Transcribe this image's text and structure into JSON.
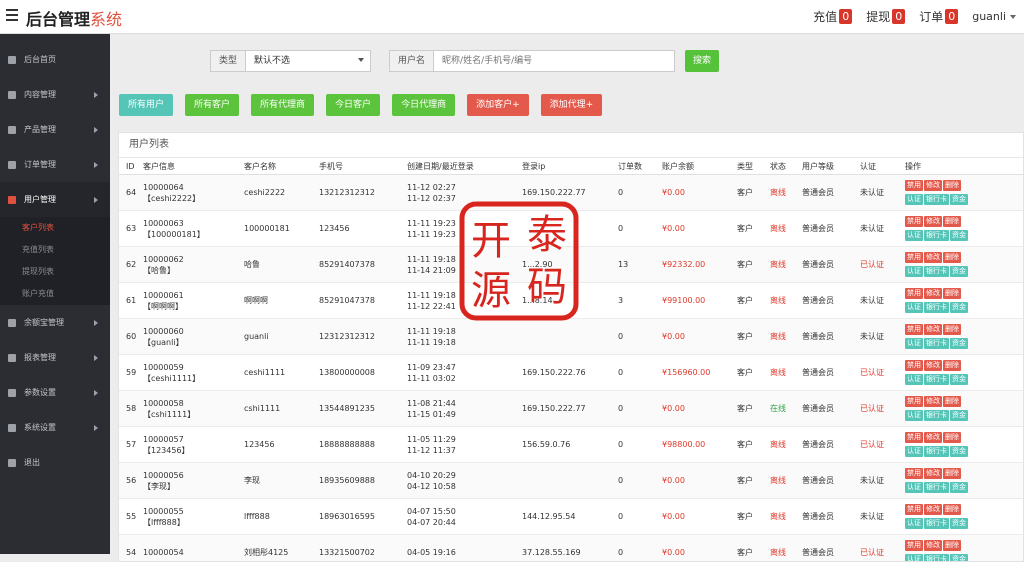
{
  "header": {
    "brand_main": "后台管理",
    "brand_accent": "系统",
    "nav": [
      {
        "label": "充值",
        "count": "0"
      },
      {
        "label": "提现",
        "count": "0"
      },
      {
        "label": "订单",
        "count": "0"
      }
    ],
    "user": "guanli"
  },
  "sidebar": {
    "items": [
      {
        "label": "后台首页"
      },
      {
        "label": "内容管理"
      },
      {
        "label": "产品管理"
      },
      {
        "label": "订单管理"
      },
      {
        "label": "用户管理"
      },
      {
        "label": "余额宝管理"
      },
      {
        "label": "报表管理"
      },
      {
        "label": "参数设置"
      },
      {
        "label": "系统设置"
      },
      {
        "label": "退出"
      }
    ],
    "submenu": [
      "客户列表",
      "充值列表",
      "提现列表",
      "账户充值"
    ]
  },
  "filter": {
    "type_label": "类型",
    "type_value": "默认不选",
    "user_label": "用户名",
    "user_placeholder": "昵称/姓名/手机号/编号",
    "search_label": "搜索"
  },
  "quick_buttons": [
    "所有用户",
    "所有客户",
    "所有代理商",
    "今日客户",
    "今日代理商",
    "添加客户+",
    "添加代理+"
  ],
  "table": {
    "title": "用户列表",
    "headers": [
      "ID",
      "客户信息",
      "客户名称",
      "手机号",
      "创建日期/最近登录",
      "登录ip",
      "订单数",
      "账户余额",
      "类型",
      "状态",
      "用户等级",
      "认证",
      "操作"
    ],
    "ops": [
      "禁用",
      "修改",
      "删除",
      "认证",
      "银行卡",
      "资金"
    ],
    "rows": [
      {
        "id": "64",
        "code": "10000064",
        "nick": "【ceshi2222】",
        "name": "ceshi2222",
        "phone": "13212312312",
        "created": "11-12 02:27",
        "login": "11-12 02:37",
        "ip": "169.150.222.77",
        "orders": "0",
        "balance": "¥0.00",
        "type": "客户",
        "status": "离线",
        "level": "普通会员",
        "auth": "未认证"
      },
      {
        "id": "63",
        "code": "10000063",
        "nick": "【100000181】",
        "name": "100000181",
        "phone": "123456",
        "created": "11-11 19:23",
        "login": "11-11 19:23",
        "ip": "",
        "orders": "0",
        "balance": "¥0.00",
        "type": "客户",
        "status": "离线",
        "level": "普通会员",
        "auth": "未认证"
      },
      {
        "id": "62",
        "code": "10000062",
        "nick": "【哈鲁】",
        "name": "哈鲁",
        "phone": "85291407378",
        "created": "11-11 19:18",
        "login": "11-14 21:09",
        "ip": "1...2.90",
        "orders": "13",
        "balance": "¥92332.00",
        "type": "客户",
        "status": "离线",
        "level": "普通会员",
        "auth": "已认证"
      },
      {
        "id": "61",
        "code": "10000061",
        "nick": "【啊啊啊】",
        "name": "啊啊啊",
        "phone": "85291047378",
        "created": "11-11 19:18",
        "login": "11-12 22:41",
        "ip": "1...8.14",
        "orders": "3",
        "balance": "¥99100.00",
        "type": "客户",
        "status": "离线",
        "level": "普通会员",
        "auth": "未认证"
      },
      {
        "id": "60",
        "code": "10000060",
        "nick": "【guanli】",
        "name": "guanli",
        "phone": "12312312312",
        "created": "11-11 19:18",
        "login": "11-11 19:18",
        "ip": "",
        "orders": "0",
        "balance": "¥0.00",
        "type": "客户",
        "status": "离线",
        "level": "普通会员",
        "auth": "未认证"
      },
      {
        "id": "59",
        "code": "10000059",
        "nick": "【ceshi1111】",
        "name": "ceshi1111",
        "phone": "13800000008",
        "created": "11-09 23:47",
        "login": "11-11 03:02",
        "ip": "169.150.222.76",
        "orders": "0",
        "balance": "¥156960.00",
        "type": "客户",
        "status": "离线",
        "level": "普通会员",
        "auth": "已认证"
      },
      {
        "id": "58",
        "code": "10000058",
        "nick": "【cshi1111】",
        "name": "cshi1111",
        "phone": "13544891235",
        "created": "11-08 21:44",
        "login": "11-15 01:49",
        "ip": "169.150.222.77",
        "orders": "0",
        "balance": "¥0.00",
        "type": "客户",
        "status": "在线",
        "level": "普通会员",
        "auth": "已认证"
      },
      {
        "id": "57",
        "code": "10000057",
        "nick": "【123456】",
        "name": "123456",
        "phone": "18888888888",
        "created": "11-05 11:29",
        "login": "11-12 11:37",
        "ip": "156.59.0.76",
        "orders": "0",
        "balance": "¥98800.00",
        "type": "客户",
        "status": "离线",
        "level": "普通会员",
        "auth": "已认证"
      },
      {
        "id": "56",
        "code": "10000056",
        "nick": "【李现】",
        "name": "李现",
        "phone": "18935609888",
        "created": "04-10 20:29",
        "login": "04-12 10:58",
        "ip": "",
        "orders": "0",
        "balance": "¥0.00",
        "type": "客户",
        "status": "离线",
        "level": "普通会员",
        "auth": "未认证"
      },
      {
        "id": "55",
        "code": "10000055",
        "nick": "【lfff888】",
        "name": "lfff888",
        "phone": "18963016595",
        "created": "04-07 15:50",
        "login": "04-07 20:44",
        "ip": "144.12.95.54",
        "orders": "0",
        "balance": "¥0.00",
        "type": "客户",
        "status": "离线",
        "level": "普通会员",
        "auth": "未认证"
      },
      {
        "id": "54",
        "code": "10000054",
        "nick": "",
        "name": "刘相彤4125",
        "phone": "13321500702",
        "created": "04-05 19:16",
        "login": "",
        "ip": "37.128.55.169",
        "orders": "0",
        "balance": "¥0.00",
        "type": "客户",
        "status": "离线",
        "level": "普通会员",
        "auth": "已认证"
      }
    ]
  },
  "watermark": {
    "chars": [
      "开",
      "泰",
      "源",
      "码"
    ],
    "color": "#d8261f"
  }
}
